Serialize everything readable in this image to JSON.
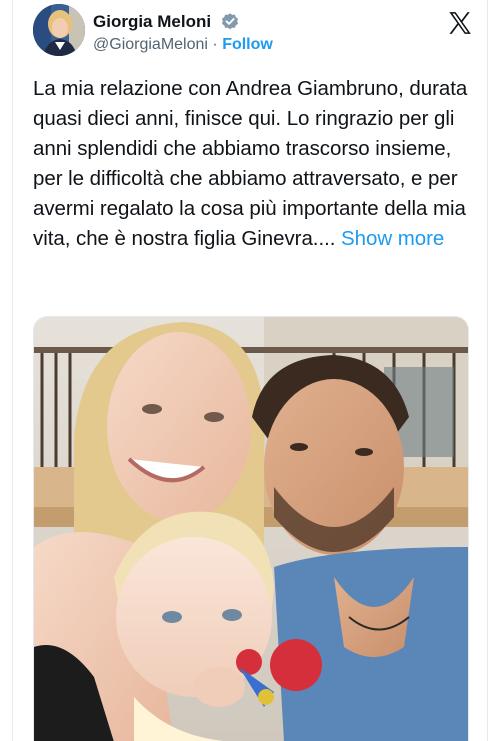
{
  "author": {
    "display_name": "Giorgia Meloni",
    "handle": "@GiorgiaMeloni",
    "separator": "·",
    "follow_label": "Follow",
    "verified_icon": "verified-badge-icon"
  },
  "platform_icon": "x-logo-icon",
  "tweet": {
    "text": "La mia relazione con Andrea Giambruno, durata quasi dieci anni, finisce qui. Lo ringrazio per gli anni splendidi che abbiamo trascorso insieme, per le difficoltà che abbiamo attraversato, e per avermi regalato la cosa più importante della mia vita, che è nostra figlia Ginevra....",
    "show_more_label": "Show more"
  },
  "colors": {
    "link": "#1d9bf0",
    "text": "#0f1419",
    "secondary_text": "#536471"
  }
}
